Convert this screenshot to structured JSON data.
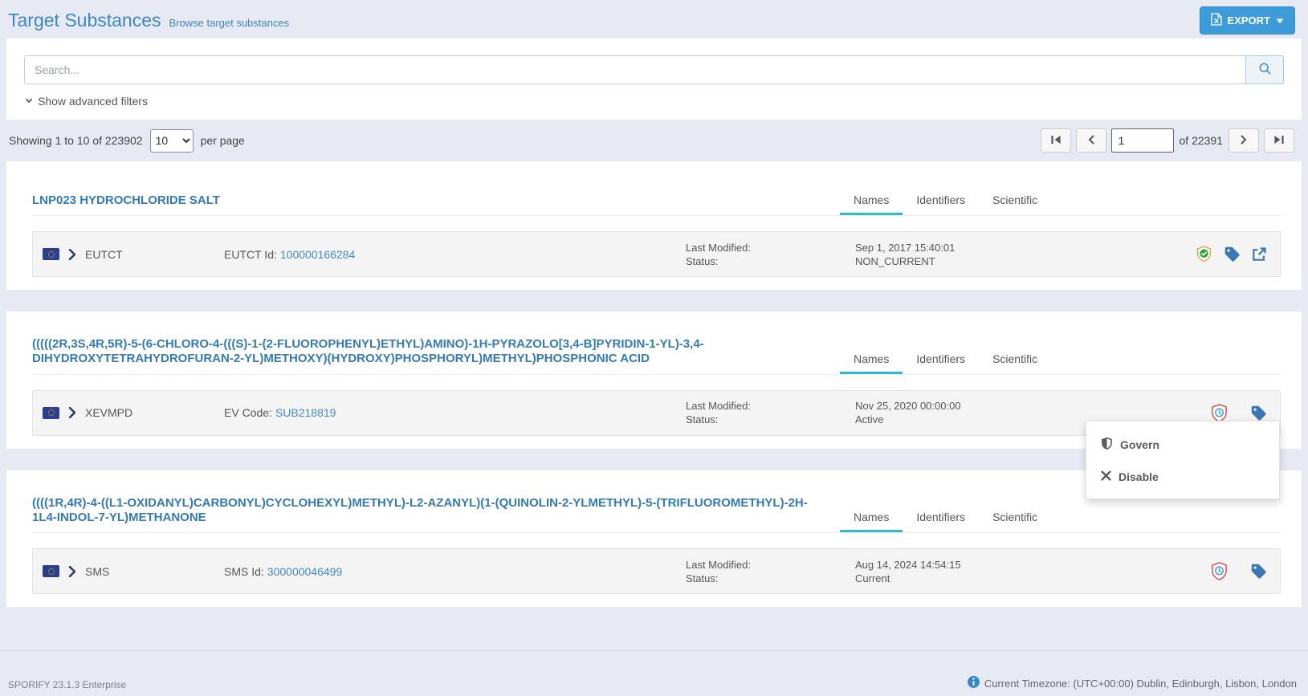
{
  "header": {
    "title": "Target Substances",
    "subtitle": "Browse target substances",
    "export_label": "EXPORT"
  },
  "search": {
    "placeholder": "Search...",
    "advanced_filters_label": "Show advanced filters"
  },
  "pagination": {
    "showing_text": "Showing 1 to 10 of 223902",
    "per_page_value": "10",
    "per_page_suffix": "per page",
    "current_page": "1",
    "total_pages_text": "of 22391"
  },
  "tabs": {
    "names": "Names",
    "identifiers": "Identifiers",
    "scientific": "Scientific"
  },
  "row_labels": {
    "last_modified": "Last Modified:",
    "status": "Status:"
  },
  "substances": [
    {
      "title": "LNP023 HYDROCHLORIDE SALT",
      "source": "EUTCT",
      "id_label": "EUTCT Id:",
      "id_value": "100000166284",
      "last_modified_value": "Sep 1, 2017 15:40:01",
      "status_value": "NON_CURRENT",
      "icons": [
        "shield-check-icon",
        "tag-icon",
        "external-link-icon"
      ]
    },
    {
      "title": "(((((2R,3S,4R,5R)-5-(6-CHLORO-4-(((S)-1-(2-FLUOROPHENYL)ETHYL)AMINO)-1H-PYRAZOLO[3,4-B]PYRIDIN-1-YL)-3,4-DIHYDROXYTETRAHYDROFURAN-2-YL)METHOXY)(HYDROXY)PHOSPHORYL)METHYL)PHOSPHONIC ACID",
      "source": "XEVMPD",
      "id_label": "EV Code:",
      "id_value": "SUB218819",
      "last_modified_value": "Nov 25, 2020 00:00:00",
      "status_value": "Active",
      "icons": [
        "shield-clock-icon",
        "tag-icon"
      ]
    },
    {
      "title": "((((1R,4R)-4-((L1-OXIDANYL)CARBONYL)CYCLOHEXYL)METHYL)-L2-AZANYL)(1-(QUINOLIN-2-YLMETHYL)-5-(TRIFLUOROMETHYL)-2H-1L4-INDOL-7-YL)METHANONE",
      "source": "SMS",
      "id_label": "SMS Id:",
      "id_value": "300000046499",
      "last_modified_value": "Aug 14, 2024 14:54:15",
      "status_value": "Current",
      "icons": [
        "shield-clock-icon",
        "tag-icon"
      ]
    }
  ],
  "context_menu": {
    "govern_label": "Govern",
    "disable_label": "Disable",
    "icons": [
      "shield-icon",
      "x-icon"
    ]
  },
  "footer": {
    "left_text": "SPORIFY 23.1.3 Enterprise",
    "right_text": "Current Timezone: (UTC+00:00) Dublin, Edinburgh, Lisbon, London"
  },
  "colors": {
    "page_background": "#e8eaf3",
    "accent_blue": "#3b86c4",
    "card_title_blue": "#337ab7",
    "link_blue": "#418bca",
    "export_button_blue": "#3d9bd8",
    "tab_active_underline": "#2eb8c9",
    "shield_valid_green": "#27a344",
    "shield_valid_border": "#ddab4e",
    "shield_pending_red": "#e8443a",
    "clock_blue": "#4a9fd8",
    "tag_blue": "#3a77b5",
    "eu_flag_navy": "#2c3e8f",
    "eu_flag_gold": "#f2c500",
    "row_background": "#f4f4f4"
  }
}
